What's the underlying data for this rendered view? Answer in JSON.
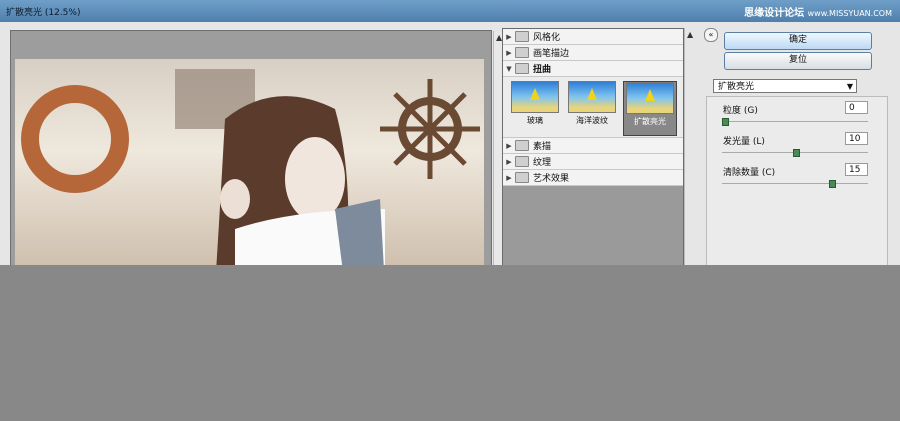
{
  "window": {
    "title": "扩散亮光 (12.5%)"
  },
  "watermark": {
    "text": "思缘设计论坛",
    "url": "www.MISSYUAN.COM"
  },
  "gallery": {
    "categories": [
      {
        "name": "风格化",
        "expanded": false
      },
      {
        "name": "画笔描边",
        "expanded": false
      },
      {
        "name": "扭曲",
        "expanded": true
      },
      {
        "name": "素描",
        "expanded": false
      },
      {
        "name": "纹理",
        "expanded": false
      },
      {
        "name": "艺术效果",
        "expanded": false
      }
    ],
    "thumbs": [
      {
        "label": "玻璃",
        "selected": false
      },
      {
        "label": "海洋波纹",
        "selected": false
      },
      {
        "label": "扩散亮光",
        "selected": true
      }
    ]
  },
  "buttons": {
    "ok": "确定",
    "reset": "复位"
  },
  "filter_select": {
    "value": "扩散亮光"
  },
  "params": [
    {
      "label": "粒度 (G)",
      "value": "0"
    },
    {
      "label": "发光量 (L)",
      "value": "10"
    },
    {
      "label": "清除数量 (C)",
      "value": "15"
    }
  ],
  "colors": {
    "titlebar": "#4f80ad",
    "accent": "#5a7fa5",
    "slider_knob": "#4a8a55"
  }
}
